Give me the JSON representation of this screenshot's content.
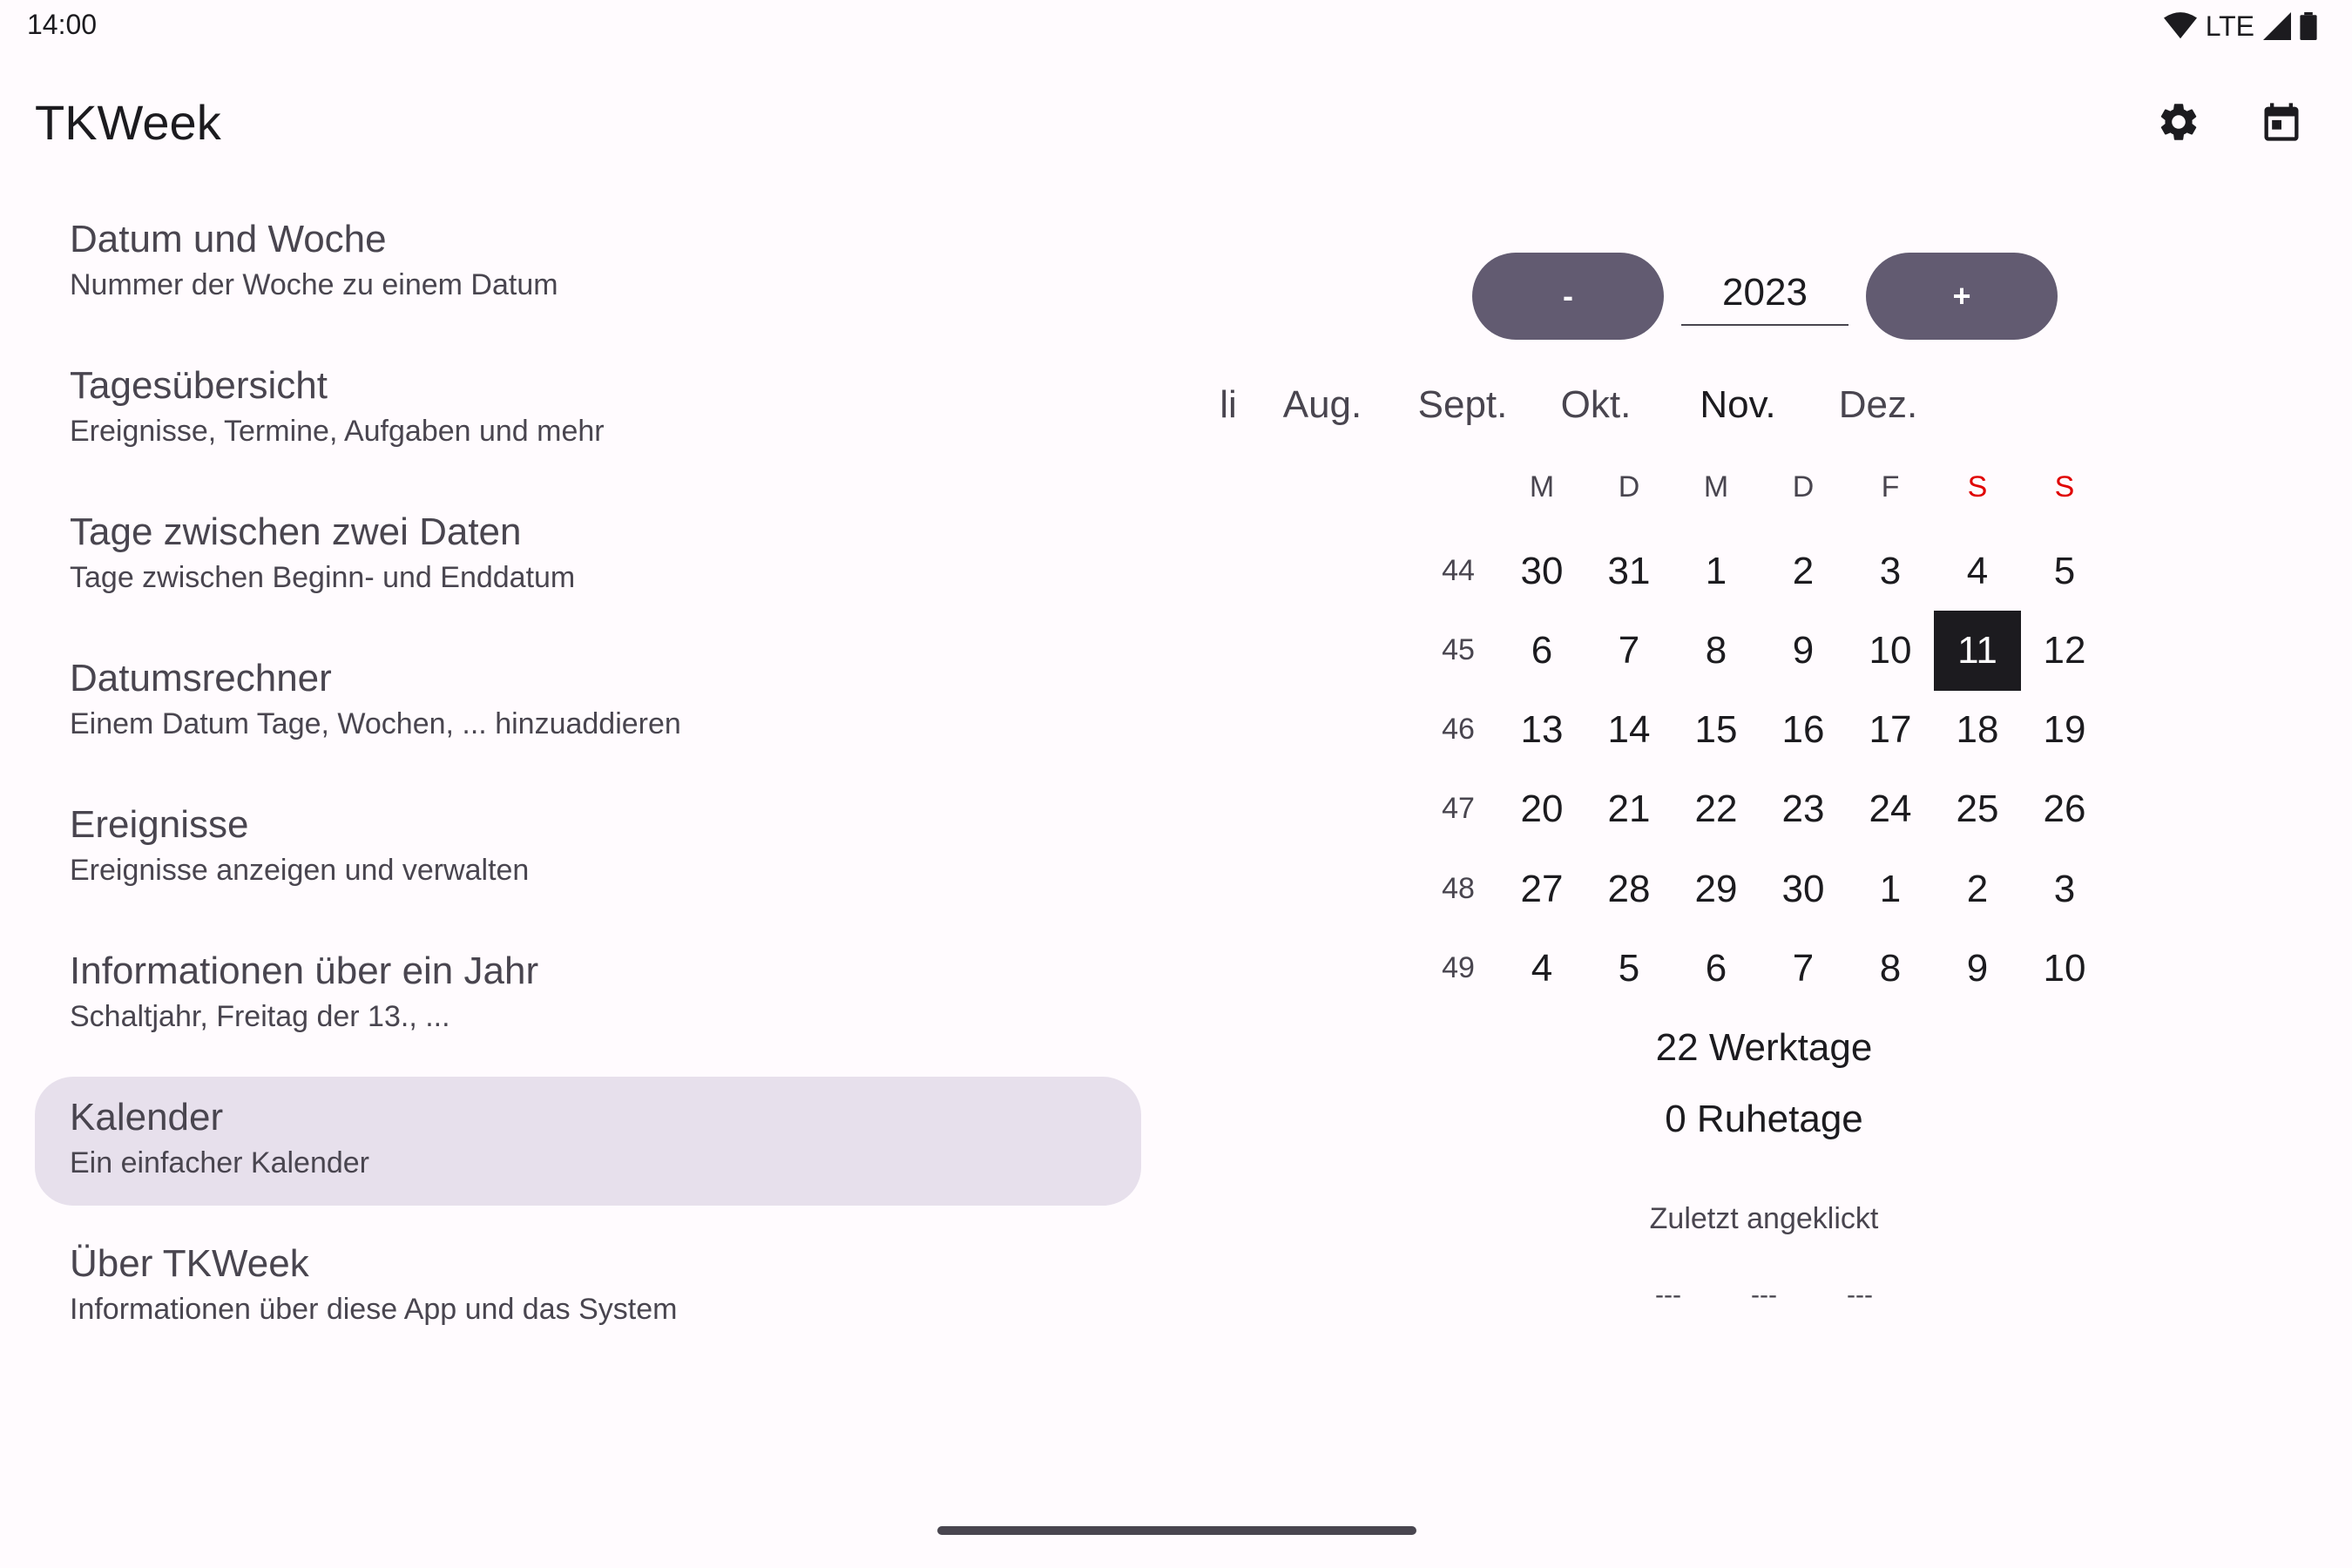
{
  "status": {
    "time": "14:00",
    "network": "LTE"
  },
  "app": {
    "title": "TKWeek"
  },
  "nav": [
    {
      "title": "Datum und Woche",
      "subtitle": "Nummer der Woche zu einem Datum"
    },
    {
      "title": "Tagesübersicht",
      "subtitle": "Ereignisse, Termine, Aufgaben und mehr"
    },
    {
      "title": "Tage zwischen zwei Daten",
      "subtitle": "Tage zwischen Beginn- und Enddatum"
    },
    {
      "title": "Datumsrechner",
      "subtitle": "Einem Datum Tage, Wochen, ... hinzuaddieren"
    },
    {
      "title": "Ereignisse",
      "subtitle": "Ereignisse anzeigen und verwalten"
    },
    {
      "title": "Informationen über ein Jahr",
      "subtitle": "Schaltjahr, Freitag der 13., ..."
    },
    {
      "title": "Kalender",
      "subtitle": "Ein einfacher Kalender"
    },
    {
      "title": "Über TKWeek",
      "subtitle": "Informationen über diese App und das System"
    }
  ],
  "calendar": {
    "minus_label": "-",
    "plus_label": "+",
    "year": "2023",
    "months": [
      "li",
      "Aug.",
      "Sept.",
      "Okt.",
      "Nov.",
      "Dez."
    ],
    "weekdays": [
      "M",
      "D",
      "M",
      "D",
      "F",
      "S",
      "S"
    ],
    "weeks": [
      {
        "num": "44",
        "days": [
          "30",
          "31",
          "1",
          "2",
          "3",
          "4",
          "5"
        ]
      },
      {
        "num": "45",
        "days": [
          "6",
          "7",
          "8",
          "9",
          "10",
          "11",
          "12"
        ]
      },
      {
        "num": "46",
        "days": [
          "13",
          "14",
          "15",
          "16",
          "17",
          "18",
          "19"
        ]
      },
      {
        "num": "47",
        "days": [
          "20",
          "21",
          "22",
          "23",
          "24",
          "25",
          "26"
        ]
      },
      {
        "num": "48",
        "days": [
          "27",
          "28",
          "29",
          "30",
          "1",
          "2",
          "3"
        ]
      },
      {
        "num": "49",
        "days": [
          "4",
          "5",
          "6",
          "7",
          "8",
          "9",
          "10"
        ]
      }
    ],
    "workdays": "22 Werktage",
    "restdays": "0 Ruhetage",
    "last_clicked_label": "Zuletzt angeklickt",
    "last_clicked_values": [
      "---",
      "---",
      "---"
    ]
  }
}
